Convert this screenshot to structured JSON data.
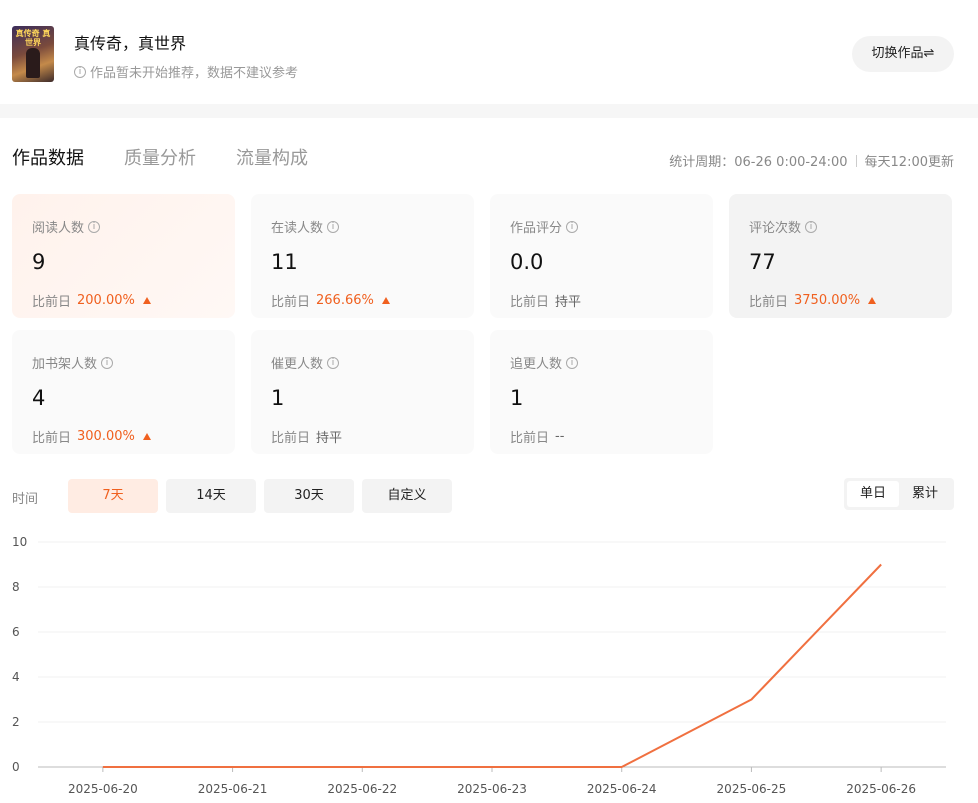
{
  "header": {
    "book_title": "真传奇，真世界",
    "cover_text": "真传奇 真世界",
    "note": "作品暂未开始推荐，数据不建议参考",
    "switch_label": "切换作品⇌"
  },
  "tabs": [
    {
      "label": "作品数据",
      "active": true
    },
    {
      "label": "质量分析",
      "active": false
    },
    {
      "label": "流量构成",
      "active": false
    }
  ],
  "period": {
    "stat": "统计周期：06-26 0:00-24:00",
    "update": "每天12:00更新"
  },
  "compare_prefix": "比前日",
  "metrics": [
    {
      "label": "阅读人数",
      "value": "9",
      "delta": "200.00%",
      "trend": "up"
    },
    {
      "label": "在读人数",
      "value": "11",
      "delta": "266.66%",
      "trend": "up"
    },
    {
      "label": "作品评分",
      "value": "0.0",
      "delta": "持平",
      "trend": "flat"
    },
    {
      "label": "评论次数",
      "value": "77",
      "delta": "3750.00%",
      "trend": "up"
    },
    {
      "label": "加书架人数",
      "value": "4",
      "delta": "300.00%",
      "trend": "up"
    },
    {
      "label": "催更人数",
      "value": "1",
      "delta": "持平",
      "trend": "flat"
    },
    {
      "label": "追更人数",
      "value": "1",
      "delta": "--",
      "trend": "flat"
    }
  ],
  "range": {
    "label": "时间",
    "options": [
      "7天",
      "14天",
      "30天",
      "自定义"
    ],
    "selected": "7天"
  },
  "mode": {
    "options": [
      "单日",
      "累计"
    ],
    "selected": "单日"
  },
  "colors": {
    "accent": "#f0601f",
    "line": "#f07040"
  },
  "chart_data": {
    "type": "line",
    "x": [
      "2025-06-20",
      "2025-06-21",
      "2025-06-22",
      "2025-06-23",
      "2025-06-24",
      "2025-06-25",
      "2025-06-26"
    ],
    "values": [
      0,
      0,
      0,
      0,
      0,
      3,
      9
    ],
    "ylim": [
      0,
      10
    ],
    "yticks": [
      0,
      2,
      4,
      6,
      8,
      10
    ],
    "grid": true
  }
}
